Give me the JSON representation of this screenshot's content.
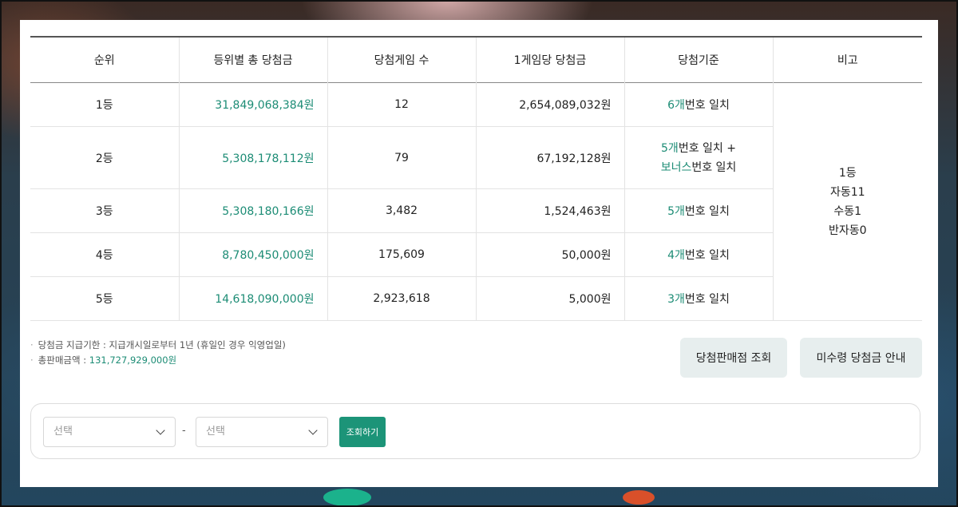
{
  "table": {
    "headers": [
      "순위",
      "등위별 총 당첨금",
      "당첨게임 수",
      "1게임당 당첨금",
      "당첨기준",
      "비고"
    ],
    "rows": [
      {
        "rank": "1등",
        "total": "31,849,068,384원",
        "games": "12",
        "per_game": "2,654,089,032원",
        "criteria": [
          {
            "hl": "6개",
            "text": "번호 일치"
          }
        ]
      },
      {
        "rank": "2등",
        "total": "5,308,178,112원",
        "games": "79",
        "per_game": "67,192,128원",
        "criteria": [
          {
            "hl": "5개",
            "text": "번호 일치 +"
          },
          {
            "hl": "보너스",
            "text": "번호 일치"
          }
        ]
      },
      {
        "rank": "3등",
        "total": "5,308,180,166원",
        "games": "3,482",
        "per_game": "1,524,463원",
        "criteria": [
          {
            "hl": "5개",
            "text": "번호 일치"
          }
        ]
      },
      {
        "rank": "4등",
        "total": "8,780,450,000원",
        "games": "175,609",
        "per_game": "50,000원",
        "criteria": [
          {
            "hl": "4개",
            "text": "번호 일치"
          }
        ]
      },
      {
        "rank": "5등",
        "total": "14,618,090,000원",
        "games": "2,923,618",
        "per_game": "5,000원",
        "criteria": [
          {
            "hl": "3개",
            "text": "번호 일치"
          }
        ]
      }
    ],
    "remarks": [
      "1등",
      "자동11",
      "수동1",
      "반자동0"
    ]
  },
  "notes": {
    "deadline": "당첨금 지급기한 : 지급개시일로부터 1년 (휴일인 경우 익영업일)",
    "sales_label": "총판매금액 : ",
    "sales_amount": "131,727,929,000원"
  },
  "buttons": {
    "store": "당첨판매점 조회",
    "unclaimed": "미수령 당첨금 안내"
  },
  "search": {
    "select_a": "선택",
    "dash": "-",
    "select_b": "선택",
    "submit": "조회하기"
  },
  "colors": {
    "accent": "#1c8c75",
    "button_green": "#1c9478",
    "button_grey": "#e7eeee"
  }
}
